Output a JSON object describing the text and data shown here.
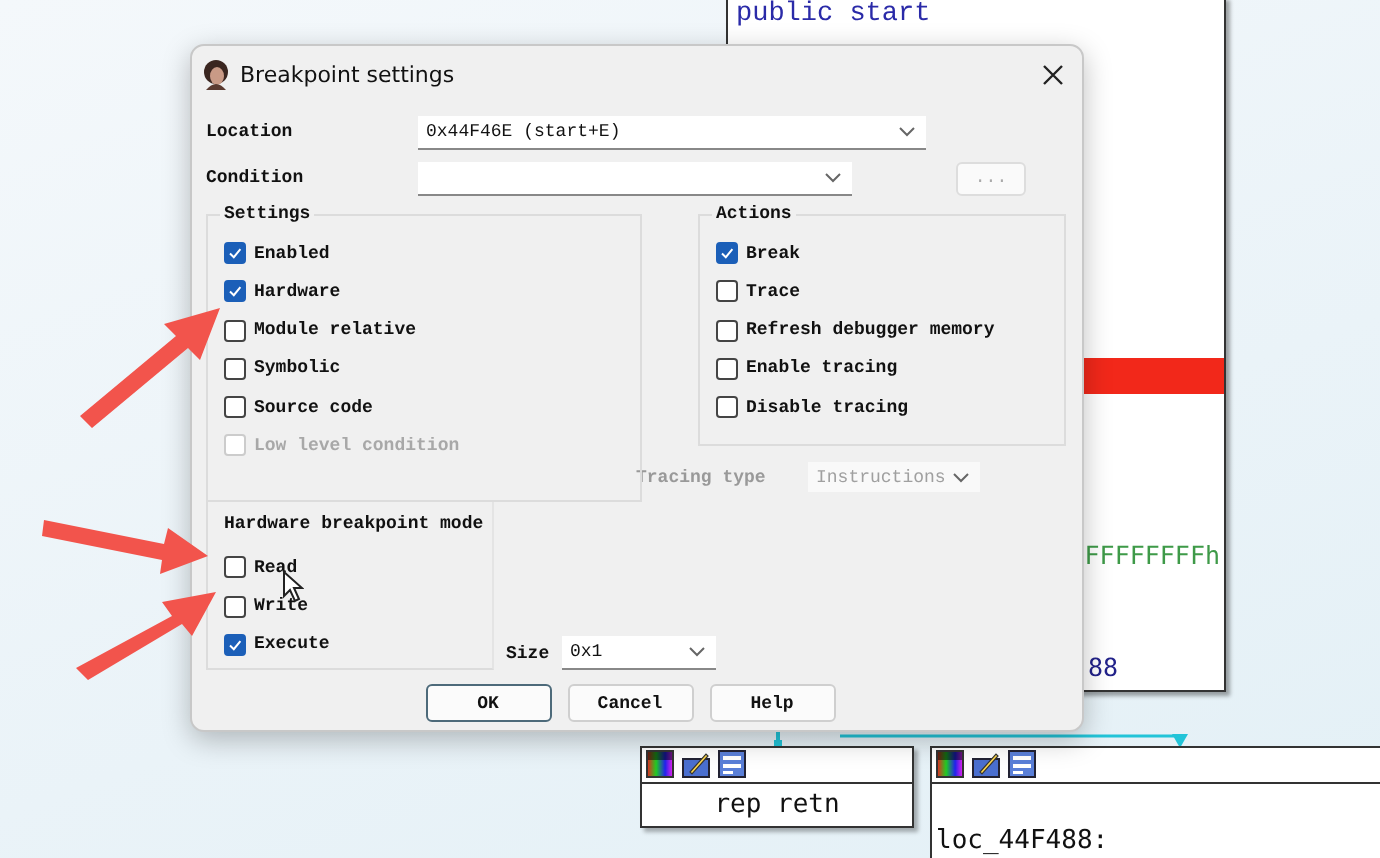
{
  "graph": {
    "main_block": {
      "lines": [
        "public start"
      ],
      "constant": "FFFFFFFFh",
      "address_tail": "88"
    },
    "nodes": [
      {
        "text": "rep retn"
      },
      {
        "text": "loc_44F488:"
      }
    ]
  },
  "dialog": {
    "title": "Breakpoint settings",
    "location": {
      "label": "Location",
      "value": "0x44F46E (start+E)"
    },
    "condition": {
      "label": "Condition"
    },
    "browse_button": "...",
    "settings": {
      "title": "Settings",
      "options": [
        {
          "label": "Enabled",
          "checked": true,
          "disabled": false
        },
        {
          "label": "Hardware",
          "checked": true,
          "disabled": false
        },
        {
          "label": "Module relative",
          "checked": false,
          "disabled": false
        },
        {
          "label": "Symbolic",
          "checked": false,
          "disabled": false
        },
        {
          "label": "Source code",
          "checked": false,
          "disabled": false
        },
        {
          "label": "Low level condition",
          "checked": false,
          "disabled": true
        }
      ]
    },
    "actions": {
      "title": "Actions",
      "options": [
        {
          "label": "Break",
          "checked": true
        },
        {
          "label": "Trace",
          "checked": false
        },
        {
          "label": "Refresh debugger memory",
          "checked": false
        },
        {
          "label": "Enable tracing",
          "checked": false
        },
        {
          "label": "Disable tracing",
          "checked": false
        }
      ]
    },
    "tracing_type": {
      "label": "Tracing type",
      "value": "Instructions",
      "disabled": true
    },
    "hardware_mode": {
      "title": "Hardware breakpoint mode",
      "options": [
        {
          "label": "Read",
          "checked": false
        },
        {
          "label": "Write",
          "checked": false
        },
        {
          "label": "Execute",
          "checked": true
        }
      ]
    },
    "size": {
      "label": "Size",
      "value": "0x1"
    },
    "buttons": [
      {
        "label": "OK",
        "default": true
      },
      {
        "label": "Cancel",
        "default": false
      },
      {
        "label": "Help",
        "default": false
      }
    ]
  }
}
